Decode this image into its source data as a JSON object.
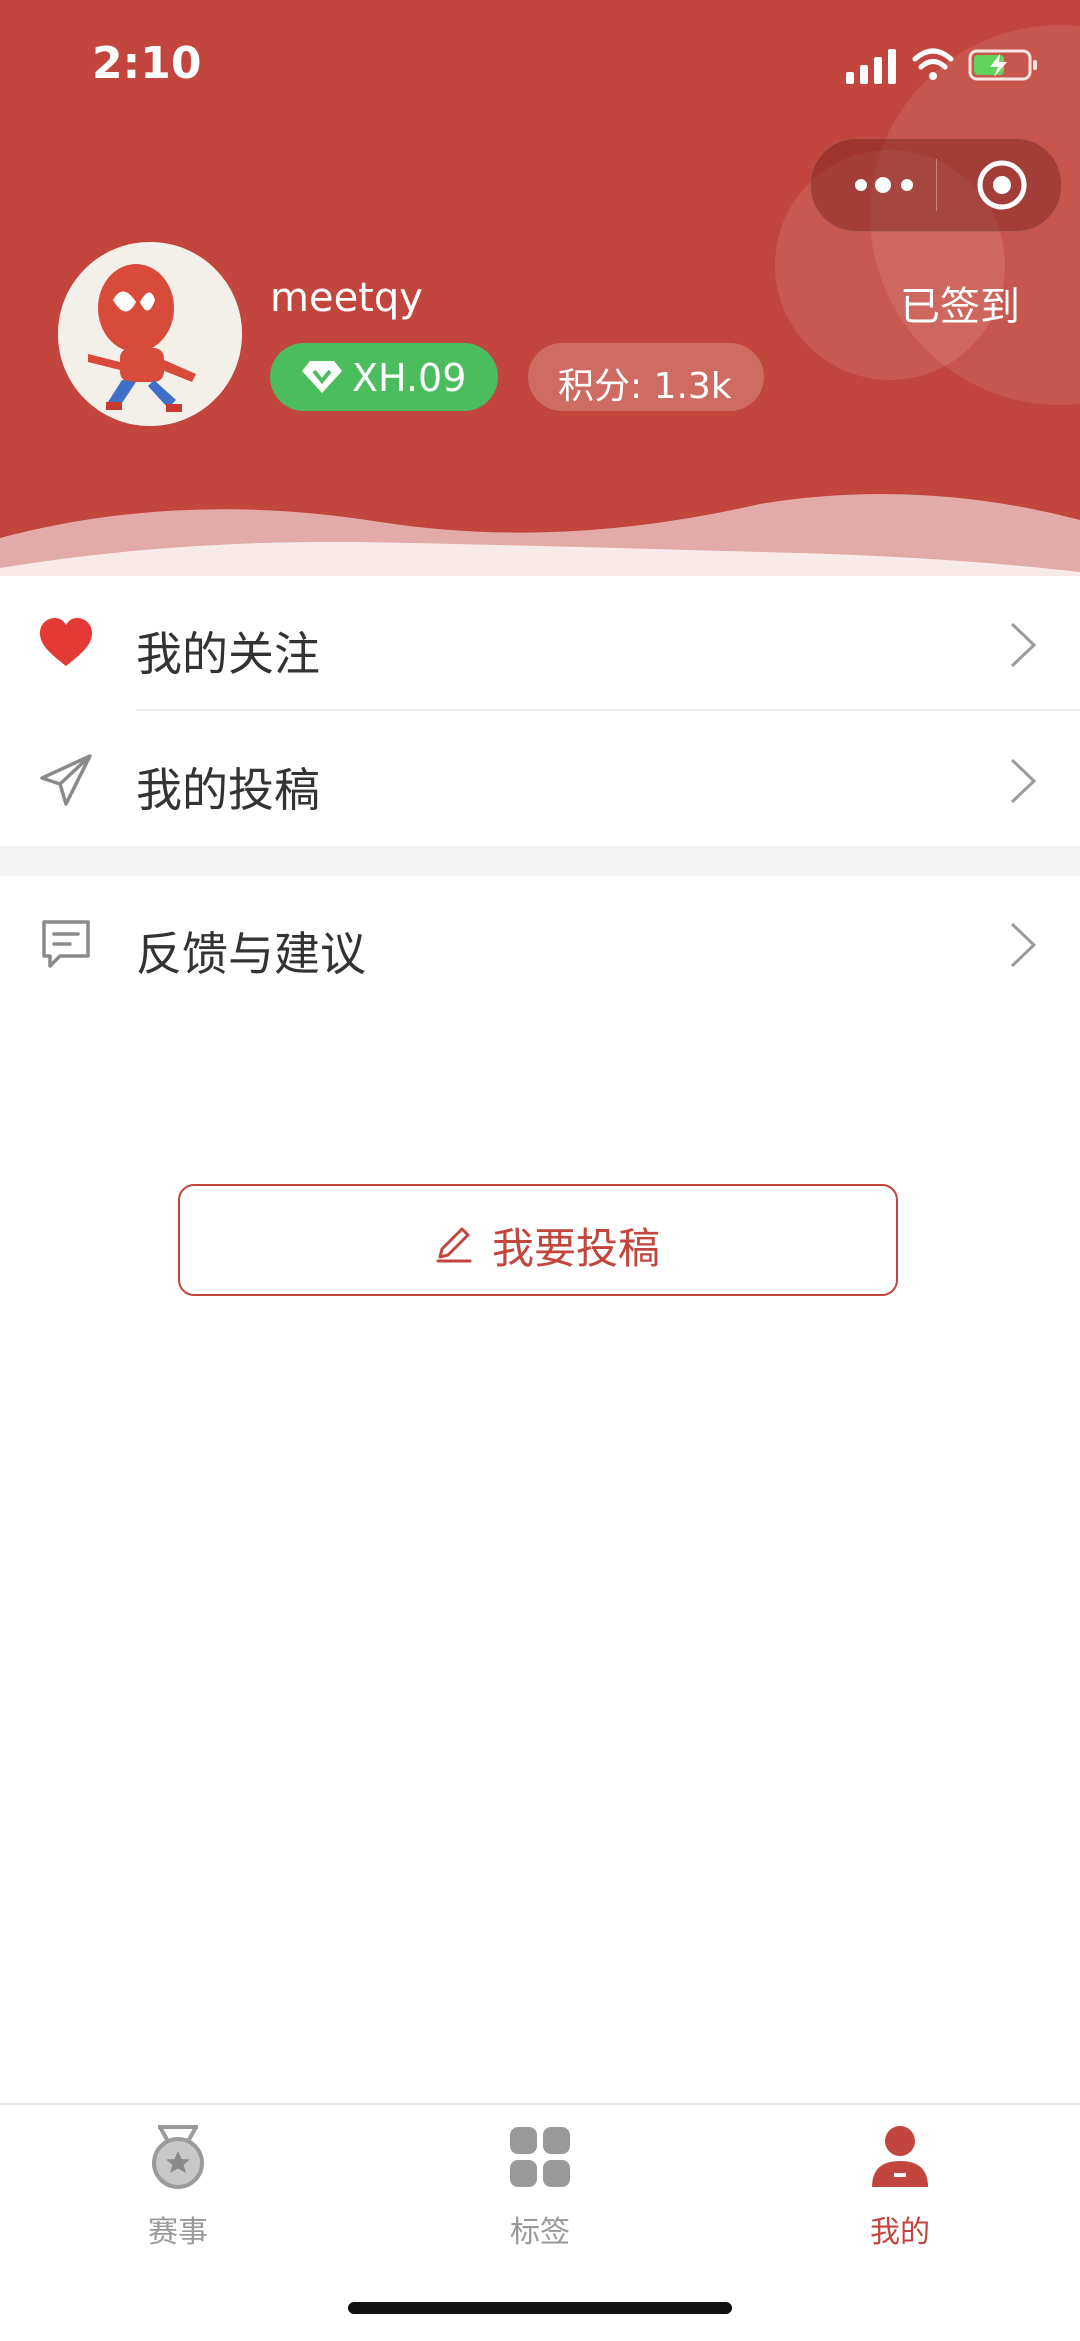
{
  "status_bar": {
    "time": "2:10"
  },
  "profile": {
    "username": "meetqy",
    "level": "XH.09",
    "points": "积分: 1.3k",
    "signin_status": "已签到"
  },
  "menu": {
    "items": [
      {
        "label": "我的关注",
        "icon": "heart-icon"
      },
      {
        "label": "我的投稿",
        "icon": "paper-plane-icon"
      },
      {
        "label": "反馈与建议",
        "icon": "message-square-icon"
      }
    ]
  },
  "submit_button": {
    "label": "我要投稿",
    "icon": "pencil-icon"
  },
  "tabbar": {
    "items": [
      {
        "label": "赛事",
        "icon": "medal-icon"
      },
      {
        "label": "标签",
        "icon": "grid-icon"
      },
      {
        "label": "我的",
        "icon": "user-icon",
        "active": true
      }
    ]
  },
  "colors": {
    "accent": "#c2463d",
    "level_badge": "#4cbd5e",
    "heart": "#e53935"
  }
}
